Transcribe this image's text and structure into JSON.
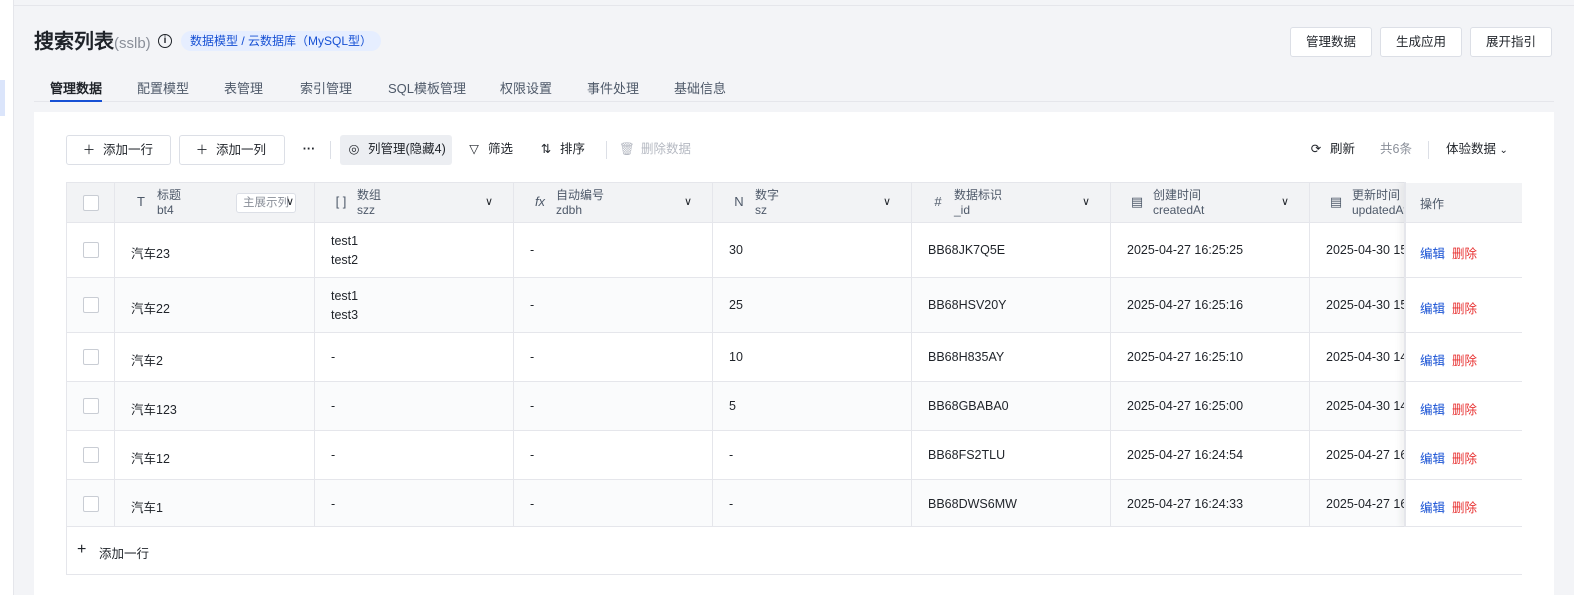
{
  "header": {
    "title": "搜索列表",
    "title_suffix": "(sslb)",
    "info_icon": "i",
    "breadcrumb": "数据模型 / 云数据库（MySQL型）",
    "buttons": [
      "管理数据",
      "生成应用",
      "展开指引"
    ]
  },
  "tabs": [
    {
      "label": "管理数据",
      "active": true
    },
    {
      "label": "配置模型"
    },
    {
      "label": "表管理"
    },
    {
      "label": "索引管理"
    },
    {
      "label": "SQL模板管理"
    },
    {
      "label": "权限设置"
    },
    {
      "label": "事件处理"
    },
    {
      "label": "基础信息"
    }
  ],
  "toolbar": {
    "add_row": "添加一行",
    "add_col": "添加一列",
    "more": "···",
    "col_manage": "列管理(隐藏4)",
    "filter": "筛选",
    "sort": "排序",
    "delete": "删除数据",
    "refresh": "刷新",
    "total": "共6条",
    "env": "体验数据"
  },
  "columns": [
    {
      "label": "标题",
      "key": "bt4",
      "icon": "T",
      "pill": "主展示列"
    },
    {
      "label": "数组",
      "key": "szz",
      "icon": "[ ]"
    },
    {
      "label": "自动编号",
      "key": "zdbh",
      "icon": "fx"
    },
    {
      "label": "数字",
      "key": "sz",
      "icon": "N"
    },
    {
      "label": "数据标识",
      "key": "_id",
      "icon": "#"
    },
    {
      "label": "创建时间",
      "key": "createdAt",
      "icon": "date"
    },
    {
      "label": "更新时间",
      "key": "updatedAt",
      "icon": "date"
    }
  ],
  "ops_header": "操作",
  "ops": {
    "edit": "编辑",
    "delete": "删除"
  },
  "rows": [
    {
      "title": "汽车23",
      "array": [
        "test1",
        "test2"
      ],
      "auto": "-",
      "num": "30",
      "id": "BB68JK7Q5E",
      "created": "2025-04-27 16:25:25",
      "updated": "2025-04-30 15"
    },
    {
      "title": "汽车22",
      "array": [
        "test1",
        "test3"
      ],
      "auto": "-",
      "num": "25",
      "id": "BB68HSV20Y",
      "created": "2025-04-27 16:25:16",
      "updated": "2025-04-30 15"
    },
    {
      "title": "汽车2",
      "array": [
        "-"
      ],
      "auto": "-",
      "num": "10",
      "id": "BB68H835AY",
      "created": "2025-04-27 16:25:10",
      "updated": "2025-04-30 14"
    },
    {
      "title": "汽车123",
      "array": [
        "-"
      ],
      "auto": "-",
      "num": "5",
      "id": "BB68GBABA0",
      "created": "2025-04-27 16:25:00",
      "updated": "2025-04-30 14"
    },
    {
      "title": "汽车12",
      "array": [
        "-"
      ],
      "auto": "-",
      "num": "-",
      "id": "BB68FS2TLU",
      "created": "2025-04-27 16:24:54",
      "updated": "2025-04-27 16"
    },
    {
      "title": "汽车1",
      "array": [
        "-"
      ],
      "auto": "-",
      "num": "-",
      "id": "BB68DWS6MW",
      "created": "2025-04-27 16:24:33",
      "updated": "2025-04-27 16"
    }
  ],
  "footer": {
    "add_row": "添加一行"
  }
}
